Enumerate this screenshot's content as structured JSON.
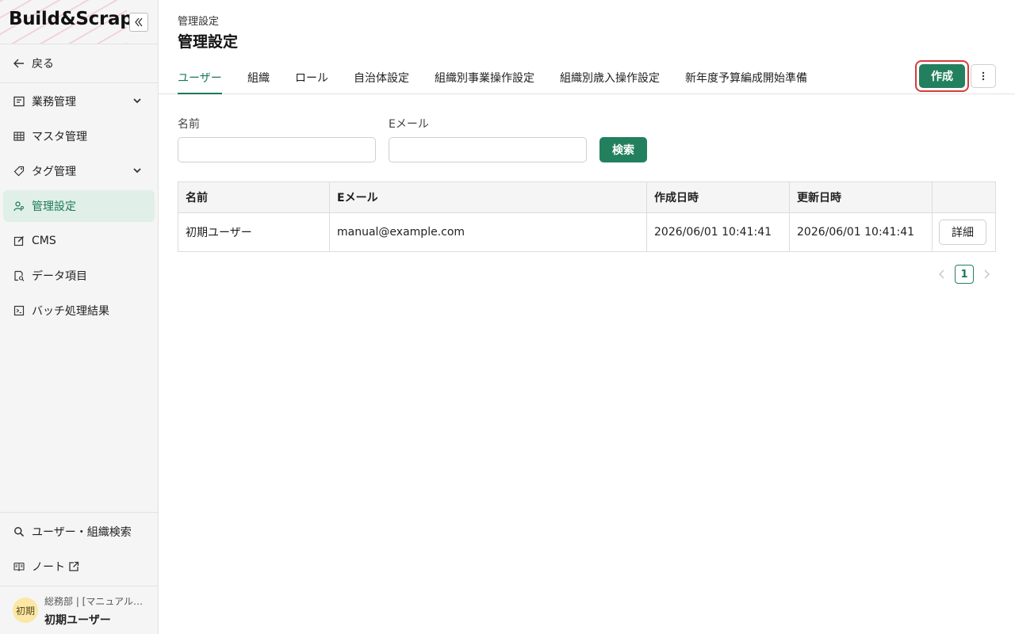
{
  "app": {
    "logo_text": "Build&Scrap",
    "collapse_icon": "double-chevron-left-icon"
  },
  "sidebar": {
    "back_label": "戻る",
    "items": [
      {
        "label": "業務管理",
        "icon": "ledger-icon",
        "expandable": true,
        "active": false
      },
      {
        "label": "マスタ管理",
        "icon": "table-icon",
        "expandable": false,
        "active": false
      },
      {
        "label": "タグ管理",
        "icon": "tag-icon",
        "expandable": true,
        "active": false
      },
      {
        "label": "管理設定",
        "icon": "users-gear-icon",
        "expandable": false,
        "active": true
      },
      {
        "label": "CMS",
        "icon": "edit-icon",
        "expandable": false,
        "active": false
      },
      {
        "label": "データ項目",
        "icon": "document-search-icon",
        "expandable": false,
        "active": false
      },
      {
        "label": "バッチ処理結果",
        "icon": "terminal-icon",
        "expandable": false,
        "active": false
      }
    ],
    "bottom_items": [
      {
        "label": "ユーザー・組織検索",
        "icon": "search-icon"
      },
      {
        "label": "ノート",
        "icon": "book-icon",
        "external": true
      }
    ],
    "user": {
      "avatar_text": "初期",
      "org_text": "総務部 | [マニュアル…",
      "name": "初期ユーザー"
    }
  },
  "header": {
    "breadcrumb": "管理設定",
    "title": "管理設定"
  },
  "tabs": [
    {
      "label": "ユーザー",
      "active": true
    },
    {
      "label": "組織",
      "active": false
    },
    {
      "label": "ロール",
      "active": false
    },
    {
      "label": "自治体設定",
      "active": false
    },
    {
      "label": "組織別事業操作設定",
      "active": false
    },
    {
      "label": "組織別歳入操作設定",
      "active": false
    },
    {
      "label": "新年度予算編成開始準備",
      "active": false
    }
  ],
  "actions": {
    "create_label": "作成",
    "more_icon": "vertical-ellipsis-icon"
  },
  "filters": {
    "name_label": "名前",
    "name_value": "",
    "email_label": "Eメール",
    "email_value": "",
    "search_label": "検索"
  },
  "table": {
    "headers": [
      "名前",
      "Eメール",
      "作成日時",
      "更新日時",
      ""
    ],
    "rows": [
      {
        "name": "初期ユーザー",
        "email": "manual@example.com",
        "created": "2026/06/01 10:41:41",
        "updated": "2026/06/01 10:41:41",
        "action": "詳細"
      }
    ]
  },
  "pagination": {
    "current": "1"
  },
  "colors": {
    "accent": "#23805f",
    "active_bg": "#e0efe8",
    "highlight": "#d63b3b"
  }
}
